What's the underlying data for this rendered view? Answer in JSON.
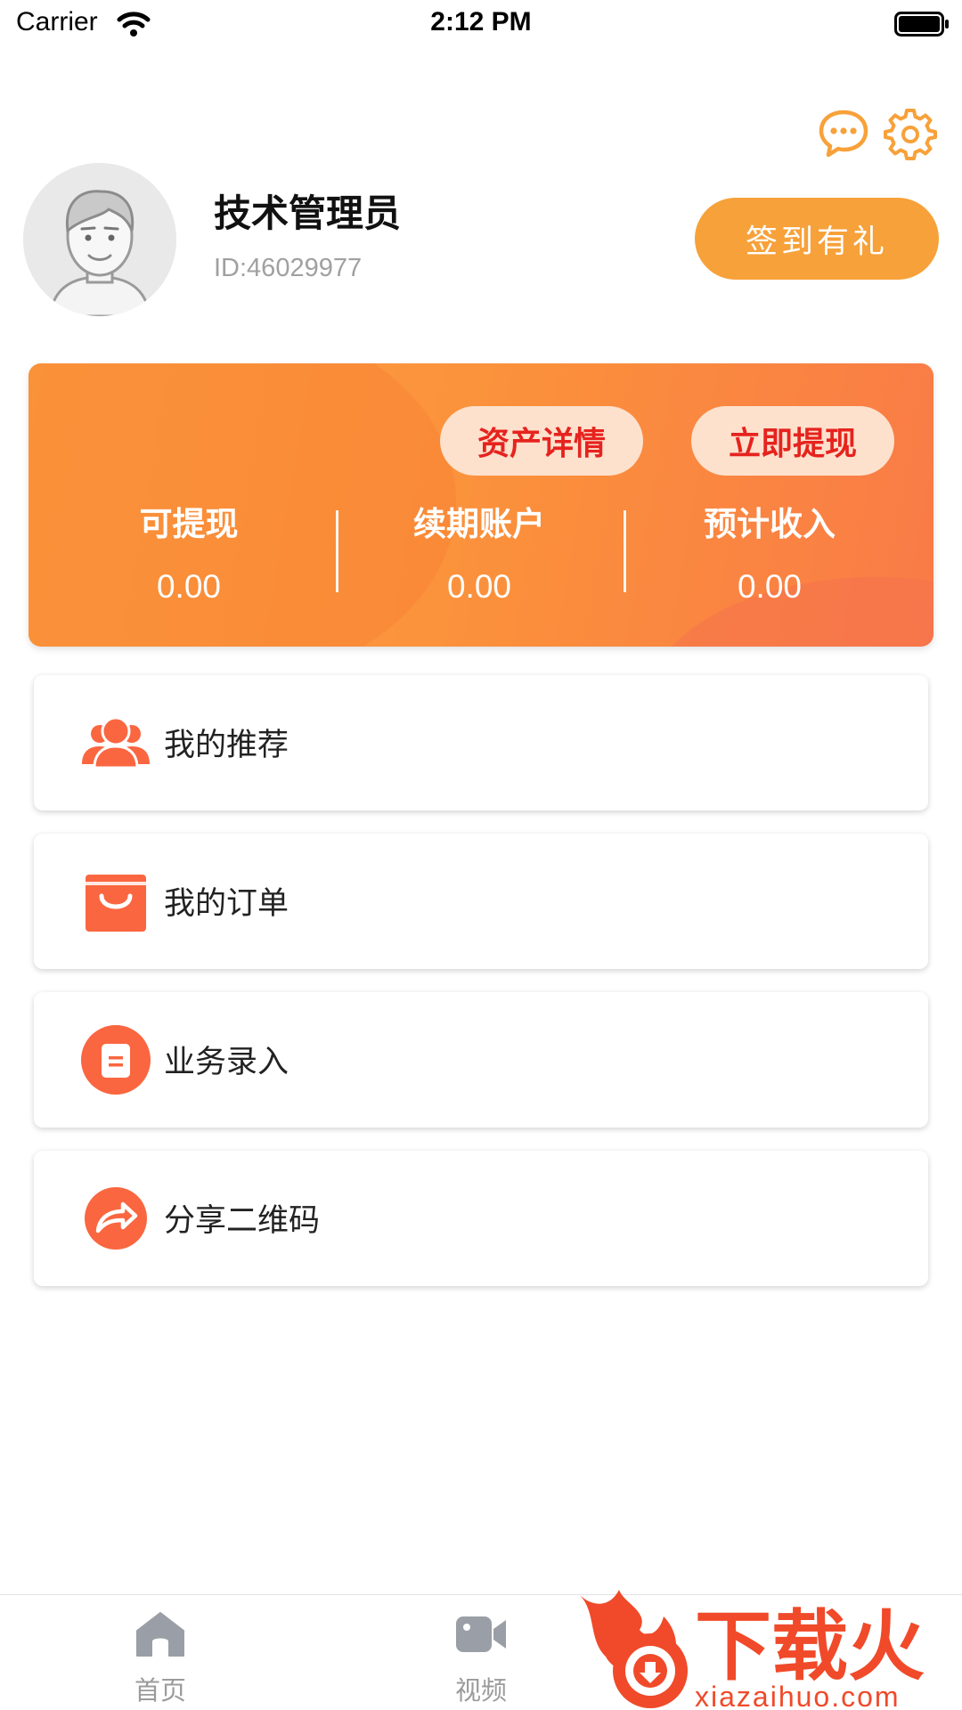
{
  "status_bar": {
    "carrier": "Carrier",
    "time": "2:12 PM"
  },
  "profile": {
    "name": "技术管理员",
    "id": "ID:46029977",
    "checkin_label": "签到有礼"
  },
  "assets": {
    "detail_label": "资产详情",
    "withdraw_label": "立即提现",
    "stats": [
      {
        "label": "可提现",
        "value": "0.00"
      },
      {
        "label": "续期账户",
        "value": "0.00"
      },
      {
        "label": "预计收入",
        "value": "0.00"
      }
    ]
  },
  "menu": [
    {
      "label": "我的推荐",
      "icon": "group-icon"
    },
    {
      "label": "我的订单",
      "icon": "shopping-bag-icon"
    },
    {
      "label": "业务录入",
      "icon": "document-icon"
    },
    {
      "label": "分享二维码",
      "icon": "share-icon"
    }
  ],
  "tabbar": [
    {
      "label": "首页",
      "icon": "home-icon"
    },
    {
      "label": "视频",
      "icon": "video-camera-icon"
    }
  ],
  "watermark": {
    "text": "下载火",
    "url_text": "xiazaihuo.com"
  },
  "colors": {
    "accent": "#f7a13a",
    "card_start": "#fba43f",
    "card_end": "#f97b47",
    "menu_icon": "#fa6640",
    "pill_text": "#e6231e"
  }
}
